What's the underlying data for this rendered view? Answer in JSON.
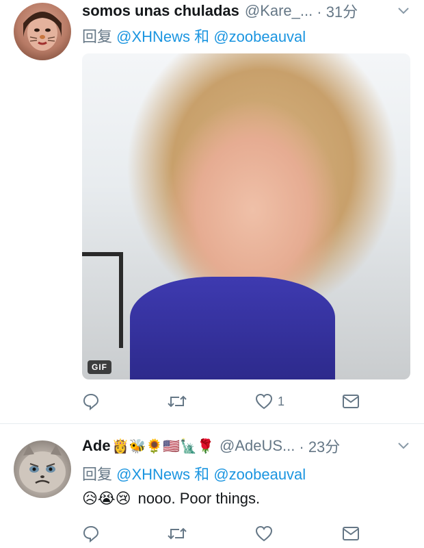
{
  "tweets": [
    {
      "name": "somos unas chuladas",
      "handle": "@Kare_...",
      "time": "· 31分",
      "reply_prefix": "回复",
      "mention1": "@XHNews",
      "reply_and": "和",
      "mention2": "@zoobeauval",
      "media": {
        "badge": "GIF"
      },
      "actions": {
        "reply_count": "",
        "retweet_count": "",
        "like_count": "1"
      },
      "icons": [
        "reply-icon",
        "retweet-icon",
        "heart-icon",
        "mail-icon",
        "chevron-down-icon"
      ]
    },
    {
      "name": "Ade",
      "name_emojis": "👸🐝🌻🇺🇸🗽🌹",
      "handle": "@AdeUS...",
      "time": "· 23分",
      "reply_prefix": "回复",
      "mention1": "@XHNews",
      "reply_and": "和",
      "mention2": "@zoobeauval",
      "body_emojis": "😥😭😢",
      "body": "nooo. Poor things.",
      "actions": {
        "reply_count": "",
        "retweet_count": "",
        "like_count": ""
      },
      "icons": [
        "reply-icon",
        "retweet-icon",
        "heart-icon",
        "mail-icon",
        "chevron-down-icon"
      ]
    }
  ],
  "colors": {
    "text": "#14171a",
    "secondary": "#657786",
    "link": "#1b95e0",
    "divider": "#e6ecf0"
  }
}
